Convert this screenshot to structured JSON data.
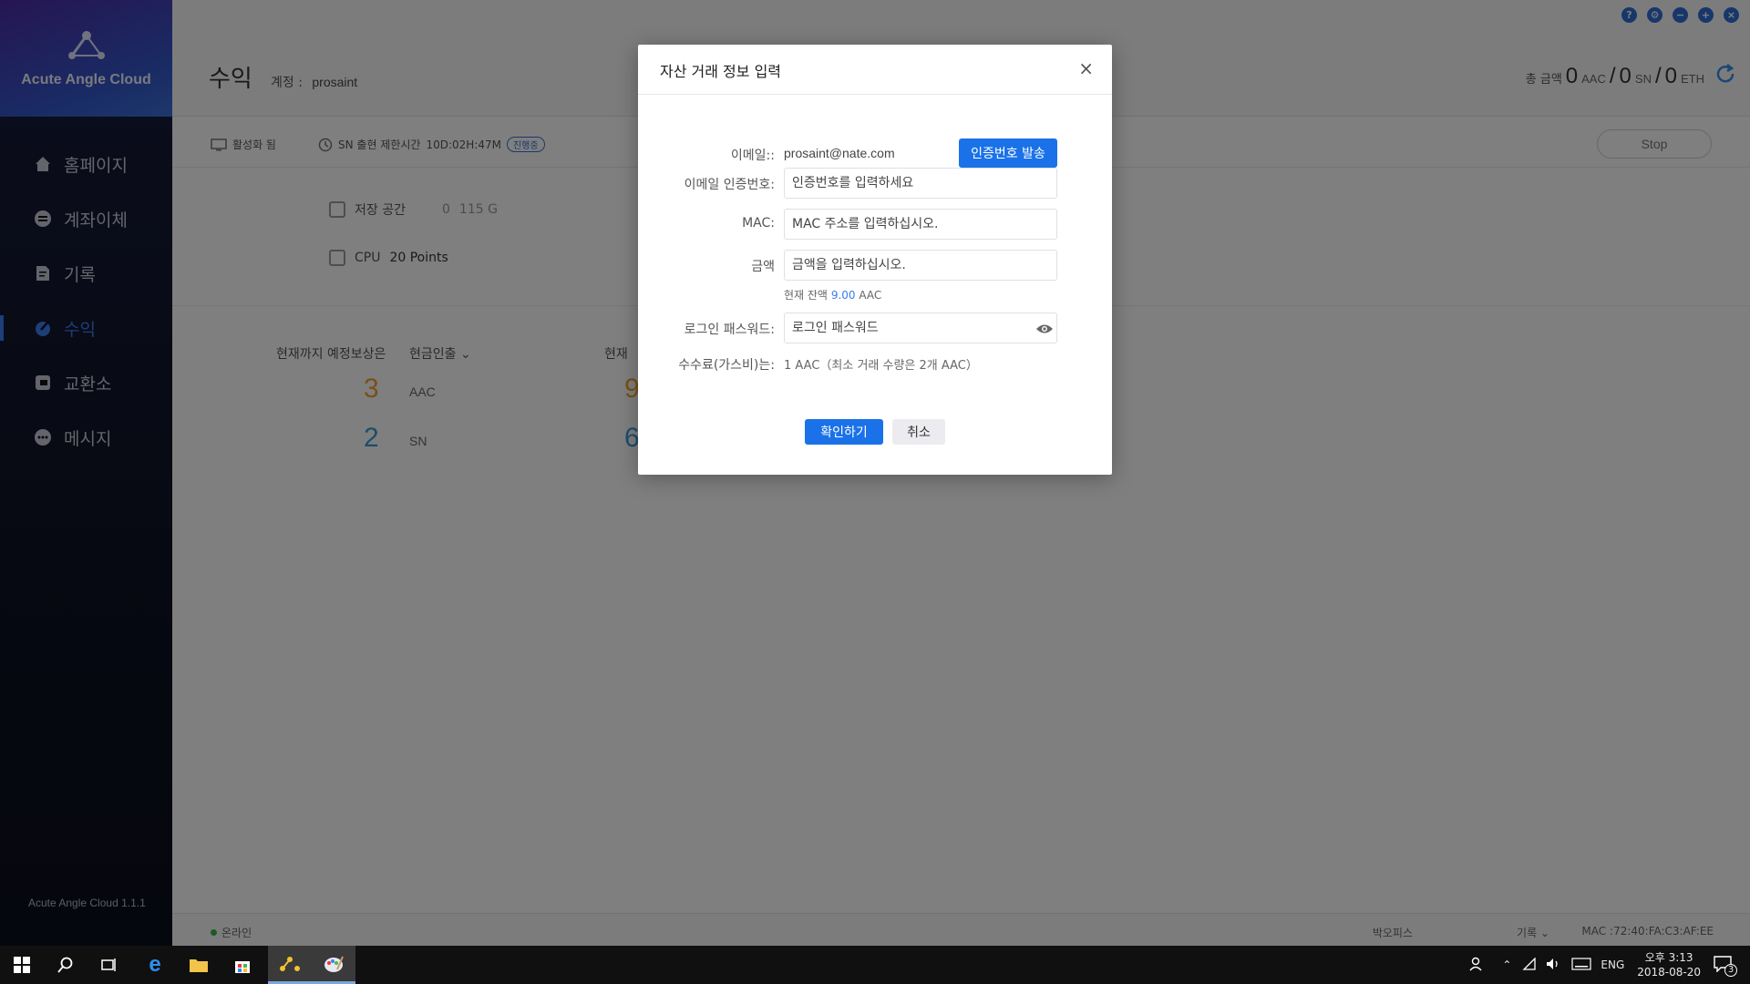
{
  "app": {
    "brand": "Acute Angle Cloud",
    "version": "Acute Angle Cloud 1.1.1"
  },
  "nav": [
    {
      "label": "홈페이지",
      "icon": "home-icon"
    },
    {
      "label": "계좌이체",
      "icon": "transfer-icon"
    },
    {
      "label": "기록",
      "icon": "record-icon"
    },
    {
      "label": "수익",
      "icon": "earnings-icon",
      "active": true
    },
    {
      "label": "교환소",
      "icon": "exchange-icon"
    },
    {
      "label": "메시지",
      "icon": "message-icon"
    }
  ],
  "header": {
    "title": "수익",
    "account_label": "계정 :",
    "account_value": "prosaint",
    "total_label": "총 금액",
    "total_aac": "0",
    "aac_unit": "AAC",
    "total_sn": "0",
    "sn_unit": "SN",
    "total_eth": "0",
    "eth_unit": "ETH",
    "slash": "/"
  },
  "status": {
    "activated": "활성화 됨",
    "sn_limit": "SN 출현 제한시간",
    "sn_time": "10D:02H:47M",
    "badge": "진행중",
    "stop": "Stop"
  },
  "resources": {
    "storage_label": "저장 공간",
    "storage_used": "0",
    "storage_total": "115 G",
    "cpu_label": "CPU",
    "cpu_value": "20 Points"
  },
  "earnings": {
    "expected_label": "현재까지 예정보상은",
    "cash_label": "현금인출",
    "current_label": "현재",
    "aac_value": "3",
    "aac_unit": "AAC",
    "sn_value": "2",
    "sn_unit": "SN",
    "right_aac": "9",
    "right_sn": "6"
  },
  "footer": {
    "online": "온라인",
    "box_office": "박오피스",
    "record": "기록",
    "mac_label": "MAC :",
    "mac_value": "72:40:FA:C3:AF:EE"
  },
  "modal": {
    "title": "자산 거래 정보 입력",
    "email_label": "이메일::",
    "email_value": "prosaint@nate.com",
    "send_code": "인증번호 발송",
    "code_label": "이메일 인증번호:",
    "code_placeholder": "인증번호를 입력하세요",
    "mac_label": "MAC:",
    "mac_placeholder": "MAC 주소를 입력하십시오.",
    "amount_label": "금액",
    "amount_placeholder": "금액을 입력하십시오.",
    "balance_label": "현재 잔액",
    "balance_value": "9.00",
    "balance_unit": "AAC",
    "password_label": "로그인 패스워드:",
    "password_placeholder": "로그인 패스워드",
    "fee_label": "수수료(가스비)는:",
    "fee_value": "1 AAC（최소 거래 수량은 2개 AAC）",
    "confirm": "확인하기",
    "cancel": "취소"
  },
  "taskbar": {
    "lang": "ENG",
    "time": "오후 3:13",
    "date": "2018-08-20",
    "notif_count": "3"
  },
  "colors": {
    "accent": "#1b72e8",
    "sidebar": "#0f1224",
    "online": "#3bb34a"
  }
}
